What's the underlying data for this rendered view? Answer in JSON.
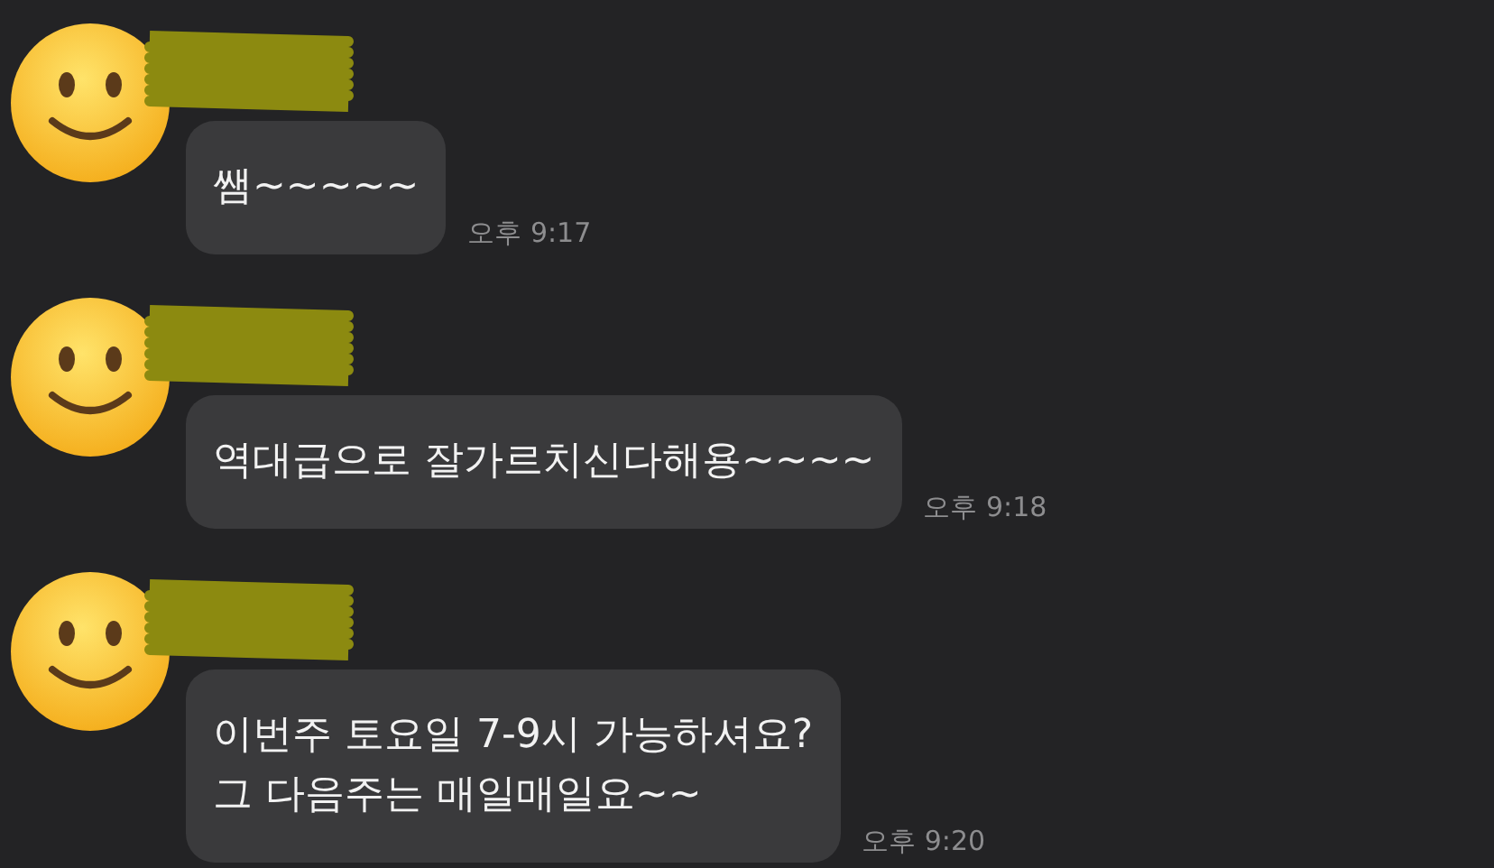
{
  "messages": [
    {
      "lines": [
        "쌤~~~~~"
      ],
      "time": "오후 9:17"
    },
    {
      "lines": [
        "역대급으로 잘가르치신다해용~~~~"
      ],
      "time": "오후 9:18"
    },
    {
      "lines": [
        "이번주 토요일 7-9시 가능하셔요?",
        "그 다음주는 매일매일요~~"
      ],
      "time": "오후 9:20"
    }
  ]
}
